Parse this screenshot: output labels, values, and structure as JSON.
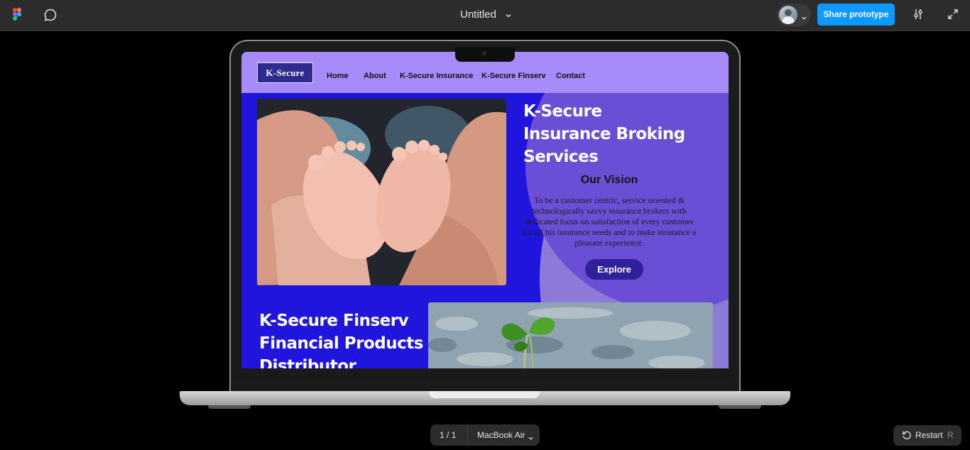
{
  "topbar": {
    "doc_title": "Untitled",
    "share_label": "Share prototype"
  },
  "site": {
    "logo": "K-Secure",
    "nav": [
      "Home",
      "About",
      "K-Secure Insurance",
      "K-Secure Finserv",
      "Contact"
    ],
    "hero_title_lines": [
      "K-Secure",
      "Insurance Broking",
      "Services"
    ],
    "vision_title": "Our Vision",
    "vision_text": "To be a customer centric, service oriented & technologically savvy insurance brokers with dedicated focus on satisfaction of every customer for all his insurance needs and to make insurance a pleasant experience.",
    "explore_label": "Explore",
    "finserv_title_lines": [
      "K-Secure Finserv",
      "Financial Products",
      "Distributor"
    ]
  },
  "bottom": {
    "page_count": "1 / 1",
    "device": "MacBook Air",
    "restart_label": "Restart",
    "restart_key": "R"
  },
  "colors": {
    "accent": "#0d99ff",
    "nav_bg": "#a78bfa",
    "hero_bg": "#2015dc",
    "button": "#2e219b"
  }
}
